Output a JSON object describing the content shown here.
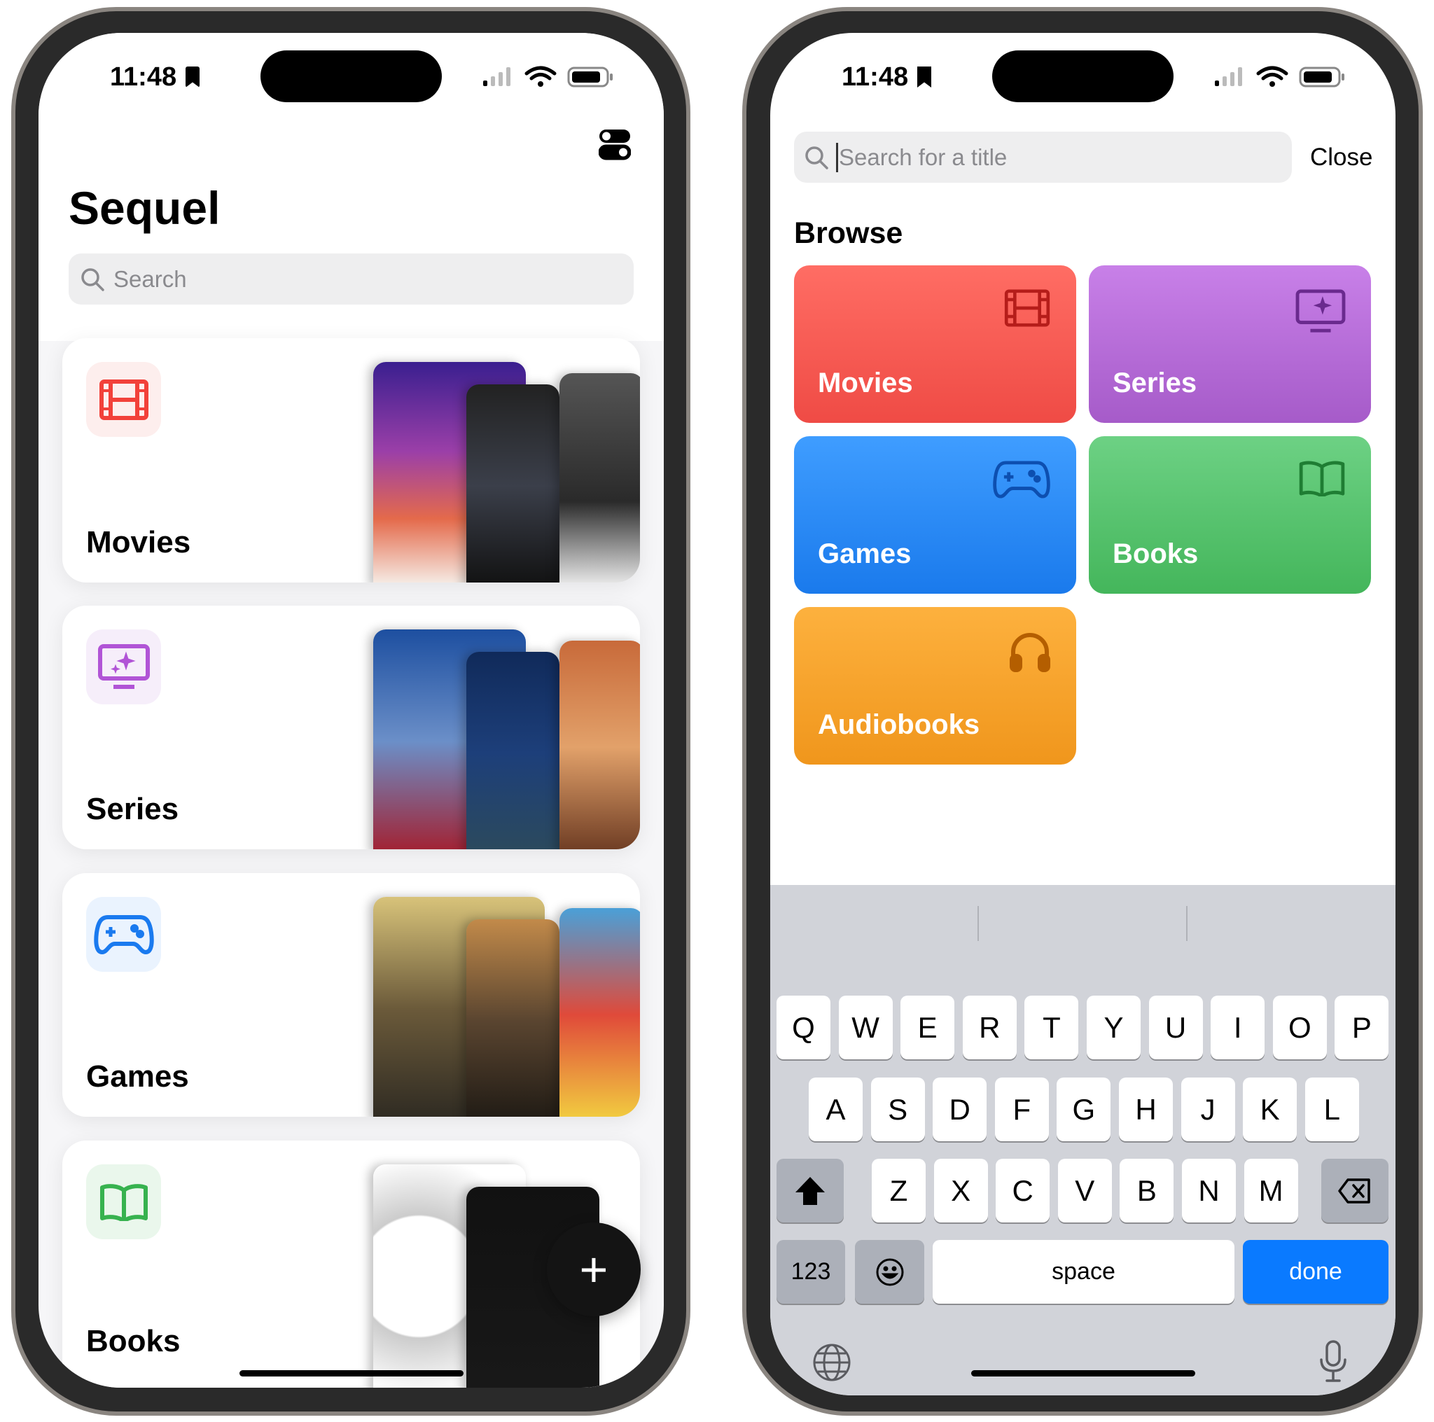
{
  "status": {
    "time": "11:48"
  },
  "left": {
    "title": "Sequel",
    "search_placeholder": "Search",
    "cards": [
      {
        "label": "Movies",
        "icon": "film-icon",
        "color": "#f2413a",
        "bg": "#fdeeed"
      },
      {
        "label": "Series",
        "icon": "tv-sparkle-icon",
        "color": "#b154d6",
        "bg": "#f6eefa"
      },
      {
        "label": "Games",
        "icon": "gamecontroller-icon",
        "color": "#1a7aef",
        "bg": "#eaf3fe"
      },
      {
        "label": "Books",
        "icon": "book-icon",
        "color": "#37b24f",
        "bg": "#eaf7ec"
      }
    ],
    "fab_label": "+"
  },
  "right": {
    "search_placeholder": "Search for a title",
    "close_label": "Close",
    "browse_title": "Browse",
    "tiles": [
      {
        "label": "Movies",
        "icon": "film-icon",
        "from": "#ff6d64",
        "to": "#ef4b45",
        "ic": "#b51d1a"
      },
      {
        "label": "Series",
        "icon": "tv-sparkle-icon",
        "from": "#c880e8",
        "to": "#a65bc9",
        "ic": "#6a2a8e"
      },
      {
        "label": "Games",
        "icon": "gamecontroller-icon",
        "from": "#3f9dff",
        "to": "#1a7aec",
        "ic": "#0d4fb0"
      },
      {
        "label": "Books",
        "icon": "book-icon",
        "from": "#6dd184",
        "to": "#44b65b",
        "ic": "#1f7d33"
      },
      {
        "label": "Audiobooks",
        "icon": "headphones-icon",
        "from": "#fdb13e",
        "to": "#f0961c",
        "ic": "#b45e00"
      }
    ],
    "keyboard": {
      "row1": [
        "Q",
        "W",
        "E",
        "R",
        "T",
        "Y",
        "U",
        "I",
        "O",
        "P"
      ],
      "row2": [
        "A",
        "S",
        "D",
        "F",
        "G",
        "H",
        "J",
        "K",
        "L"
      ],
      "row3": [
        "Z",
        "X",
        "C",
        "V",
        "B",
        "N",
        "M"
      ],
      "numbers": "123",
      "space": "space",
      "done": "done",
      "done_color": "#0a7aff"
    }
  }
}
